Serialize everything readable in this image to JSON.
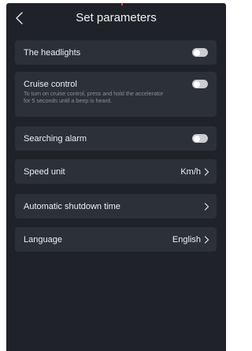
{
  "header": {
    "title": "Set parameters",
    "back_icon": "chevron-left-icon"
  },
  "settings": {
    "headlights": {
      "label": "The headlights",
      "enabled": false
    },
    "cruise": {
      "label": "Cruise control",
      "description_line1": "To turn on cruise control, press and hold the accelerator",
      "description_line2": "for 5 seconds until a beep is heard.",
      "enabled": false
    },
    "searching_alarm": {
      "label": "Searching alarm",
      "enabled": false
    },
    "speed_unit": {
      "label": "Speed unit",
      "value": "Km/h"
    },
    "shutdown": {
      "label": "Automatic shutdown time",
      "value": ""
    },
    "language": {
      "label": "Language",
      "value": "English"
    }
  },
  "colors": {
    "background": "#1f2228",
    "card": "#2c3038",
    "toggle_off": "#c9ccd1",
    "text": "#eceef1",
    "muted_text": "#8a8f98"
  }
}
